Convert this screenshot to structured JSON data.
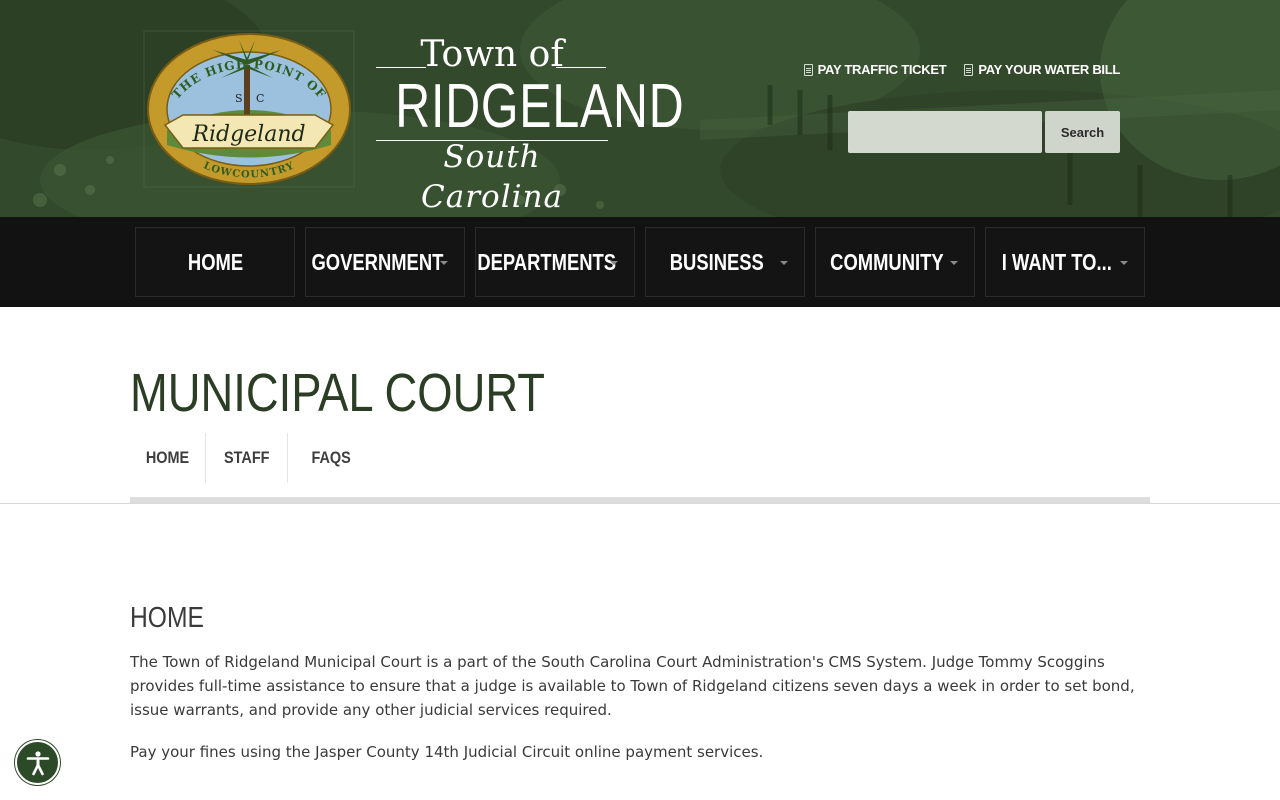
{
  "header": {
    "seal": {
      "arc_top": "THE HIGH POINT OF",
      "initials_left": "S",
      "initials_right": "C",
      "banner": "Ridgeland",
      "arc_bottom": "LOWCOUNTRY"
    },
    "wordmark": {
      "line1": "Town of",
      "line2": "RIDGELAND",
      "line3": "South Carolina"
    },
    "quick_links": [
      {
        "label": "PAY TRAFFIC TICKET",
        "icon": "document-icon"
      },
      {
        "label": "PAY YOUR WATER BILL",
        "icon": "document-icon"
      }
    ],
    "search": {
      "value": "",
      "placeholder": "",
      "button_label": "Search"
    }
  },
  "nav": {
    "items": [
      {
        "label": "HOME",
        "dropdown": false
      },
      {
        "label": "GOVERNMENT",
        "dropdown": true
      },
      {
        "label": "DEPARTMENTS",
        "dropdown": true
      },
      {
        "label": "BUSINESS",
        "dropdown": true
      },
      {
        "label": "COMMUNITY",
        "dropdown": true
      },
      {
        "label": "I WANT TO...",
        "dropdown": true
      }
    ]
  },
  "page": {
    "title": "MUNICIPAL COURT",
    "subnav": [
      {
        "label": "HOME"
      },
      {
        "label": "STAFF"
      },
      {
        "label": "FAQS"
      }
    ],
    "section_heading": "HOME",
    "paragraphs": [
      "The Town of Ridgeland Municipal Court is a part of the South Carolina Court Administration's CMS System. Judge Tommy Scoggins provides full-time assistance to ensure that a judge is available to Town of Ridgeland citizens seven days a week in order to set bond, issue warrants, and provide any other judicial services required.",
      "Pay your fines using the Jasper County 14th Judicial Circuit online payment services."
    ]
  },
  "accessibility": {
    "icon": "accessibility-person-icon"
  },
  "colors": {
    "header_green": "#35502d",
    "nav_black": "#121212",
    "title_green": "#2b3d24",
    "seal_gold": "#c49a2a",
    "accessibility_green": "#2c4a27"
  }
}
